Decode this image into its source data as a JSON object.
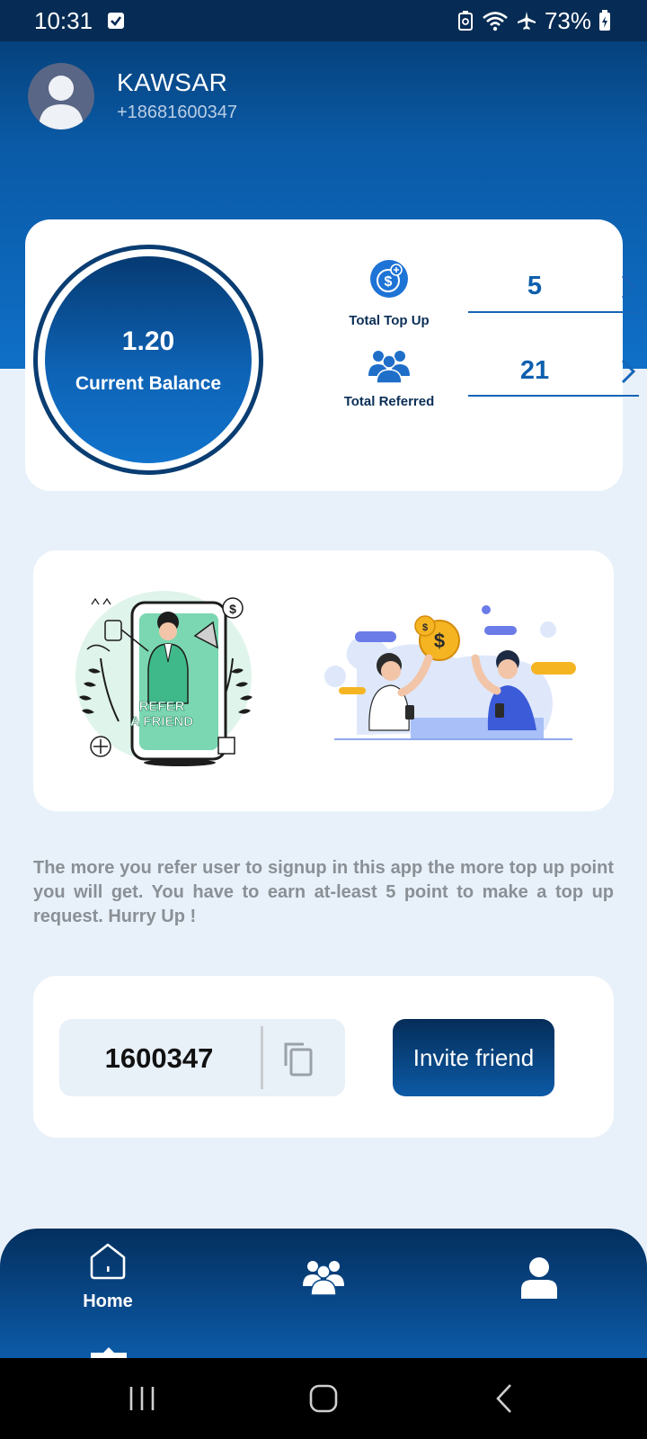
{
  "status_bar": {
    "time": "10:31",
    "battery": "73%",
    "icons": [
      "checkbox-notification-icon",
      "recycle-icon",
      "wifi-icon",
      "airplane-icon",
      "battery-icon"
    ]
  },
  "profile": {
    "name": "KAWSAR",
    "phone": "+18681600347"
  },
  "balance": {
    "value": "1.20",
    "label": "Current Balance"
  },
  "stats": {
    "top_up": {
      "label": "Total Top Up",
      "value": "5",
      "icon": "dollar-coin-icon"
    },
    "referred": {
      "label": "Total Referred",
      "value": "21",
      "icon": "users-group-icon"
    }
  },
  "illustrations": {
    "refer_text_line1": "REFER",
    "refer_text_line2": "A FRIEND"
  },
  "info": {
    "text": "The more you refer user to signup in this app the more top up point you will get. You have to earn at-least 5 point to make a top up request. Hurry Up !"
  },
  "invite": {
    "code": "1600347",
    "button_label": "Invite friend"
  },
  "bottom_nav": {
    "items": [
      {
        "label": "Home",
        "icon": "home-icon",
        "active": true
      },
      {
        "label": "",
        "icon": "users-group-icon",
        "active": false
      },
      {
        "label": "",
        "icon": "user-icon",
        "active": false
      }
    ]
  },
  "colors": {
    "primary_dark": "#062c55",
    "primary": "#0e5fae",
    "background": "#e8f1f9",
    "card": "#ffffff",
    "muted_text": "#8a9096"
  }
}
